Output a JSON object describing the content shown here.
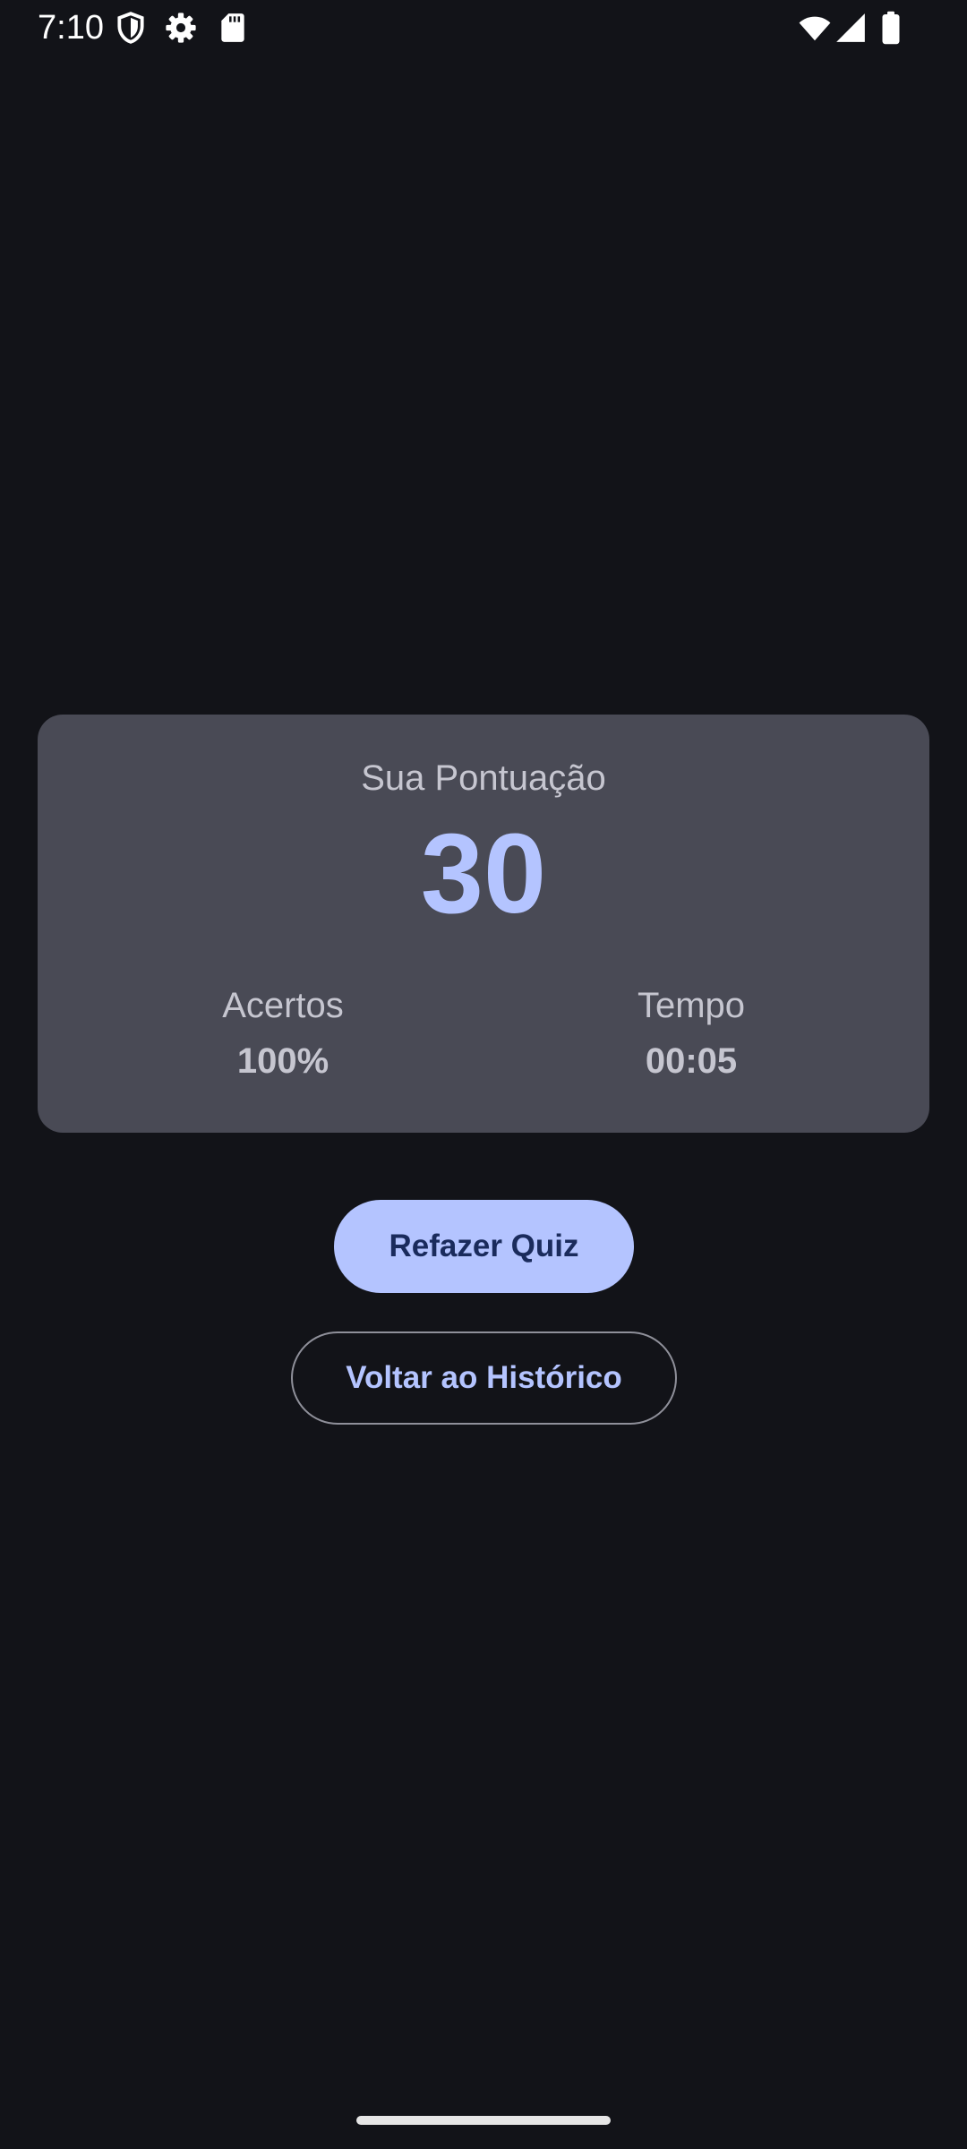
{
  "status_bar": {
    "time": "7:10",
    "left_icons": [
      "shield-icon",
      "gear-icon",
      "sd-card-icon"
    ],
    "right_icons": [
      "wifi-icon",
      "signal-icon",
      "battery-icon"
    ]
  },
  "result": {
    "score_label": "Sua Pontuação",
    "score": "30",
    "accuracy_label": "Acertos",
    "accuracy": "100%",
    "time_label": "Tempo",
    "time": "00:05"
  },
  "actions": {
    "retry_label": "Refazer Quiz",
    "history_label": "Voltar ao Histórico"
  },
  "colors": {
    "background": "#121318",
    "card": "#494a55",
    "accent": "#b4c4ff",
    "on_accent": "#1a2b5c",
    "muted_text": "#c6c6d0",
    "outline": "#8f909a"
  }
}
